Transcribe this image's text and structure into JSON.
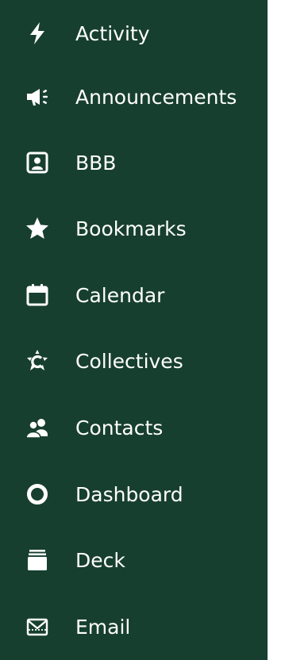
{
  "menu": {
    "background_color": "#173f30",
    "text_color": "#ffffff",
    "items": [
      {
        "label": "Activity",
        "icon": "lightning-icon"
      },
      {
        "label": "Announcements",
        "icon": "megaphone-icon"
      },
      {
        "label": "BBB",
        "icon": "video-room-icon"
      },
      {
        "label": "Bookmarks",
        "icon": "star-icon"
      },
      {
        "label": "Calendar",
        "icon": "calendar-icon"
      },
      {
        "label": "Collectives",
        "icon": "collectives-icon"
      },
      {
        "label": "Contacts",
        "icon": "contacts-icon"
      },
      {
        "label": "Dashboard",
        "icon": "circle-icon"
      },
      {
        "label": "Deck",
        "icon": "deck-icon"
      },
      {
        "label": "Email",
        "icon": "email-icon"
      }
    ]
  }
}
